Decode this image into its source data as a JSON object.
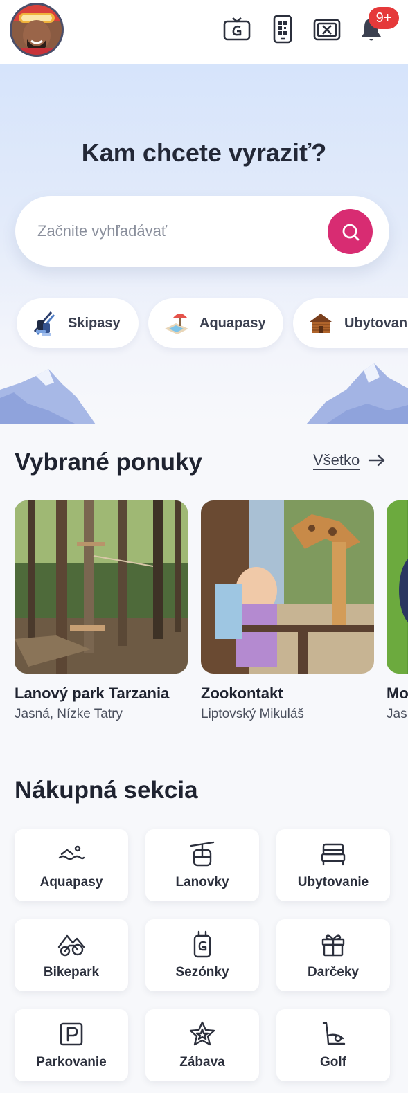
{
  "header": {
    "avatar_icon": "user-avatar",
    "icons": [
      "ticket-card-icon",
      "qr-phone-icon",
      "ticket-x-icon",
      "bell-icon"
    ],
    "notification_badge": "9+"
  },
  "hero": {
    "title": "Kam chcete vyraziť?",
    "search_placeholder": "Začnite vyhľadávať",
    "chips": [
      {
        "label": "Skipasy",
        "icon": "ski-boots-icon"
      },
      {
        "label": "Aquapasy",
        "icon": "pool-umbrella-icon"
      },
      {
        "label": "Ubytovanie",
        "icon": "cabin-icon"
      }
    ]
  },
  "offers": {
    "title": "Vybrané ponuky",
    "see_all": "Všetko",
    "cards": [
      {
        "title": "Lanový park Tarzania",
        "subtitle": "Jasná, Nízke Tatry"
      },
      {
        "title": "Zookontakt",
        "subtitle": "Liptovský Mikuláš"
      },
      {
        "title": "Mo",
        "subtitle": "Jas"
      }
    ]
  },
  "shop": {
    "title": "Nákupná sekcia",
    "tiles": [
      {
        "label": "Aquapasy",
        "icon": "swimmer-icon"
      },
      {
        "label": "Lanovky",
        "icon": "cable-car-icon"
      },
      {
        "label": "Ubytovanie",
        "icon": "bed-icon"
      },
      {
        "label": "Bikepark",
        "icon": "bike-mountain-icon"
      },
      {
        "label": "Sezónky",
        "icon": "season-pass-icon"
      },
      {
        "label": "Darčeky",
        "icon": "gift-icon"
      },
      {
        "label": "Parkovanie",
        "icon": "parking-icon"
      },
      {
        "label": "Zábava",
        "icon": "star-icon"
      },
      {
        "label": "Golf",
        "icon": "golf-cart-icon"
      }
    ]
  },
  "colors": {
    "accent": "#d82c72",
    "badge": "#e5393a",
    "text": "#1f2330"
  }
}
